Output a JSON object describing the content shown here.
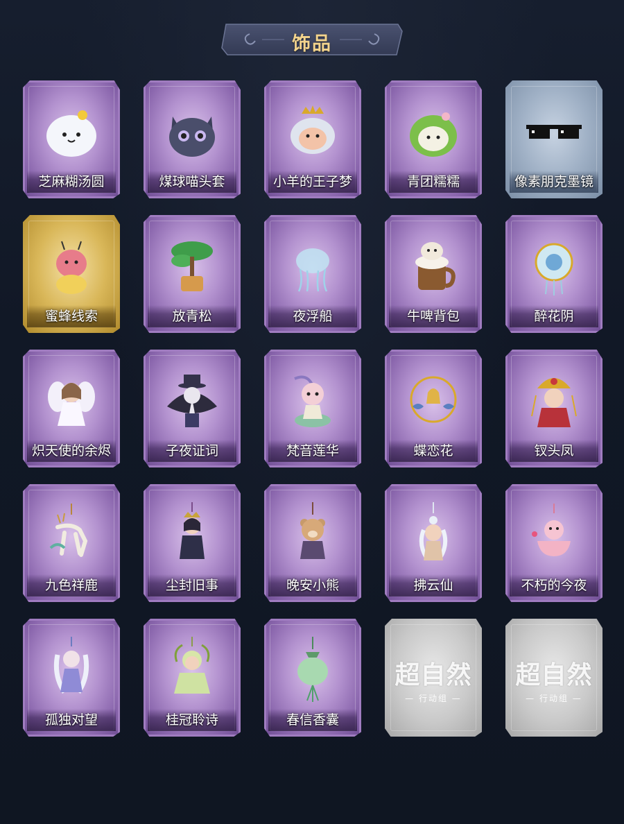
{
  "header": {
    "title": "饰品"
  },
  "items": [
    {
      "name": "芝麻糊汤圆",
      "rarity": "purple",
      "icon": "rice-ball-icon"
    },
    {
      "name": "煤球喵头套",
      "rarity": "purple",
      "icon": "cat-head-icon"
    },
    {
      "name": "小羊的王子梦",
      "rarity": "purple",
      "icon": "crowned-sheep-icon"
    },
    {
      "name": "青团糯糯",
      "rarity": "purple",
      "icon": "green-dumpling-icon"
    },
    {
      "name": "像素朋克墨镜",
      "rarity": "blue",
      "icon": "pixel-sunglasses-icon"
    },
    {
      "name": "蜜蜂线索",
      "rarity": "gold",
      "icon": "bee-costume-icon"
    },
    {
      "name": "放青松",
      "rarity": "purple",
      "icon": "bonsai-pine-icon"
    },
    {
      "name": "夜浮船",
      "rarity": "purple",
      "icon": "jellyfish-icon"
    },
    {
      "name": "牛啤背包",
      "rarity": "purple",
      "icon": "cow-beer-mug-icon"
    },
    {
      "name": "醉花阴",
      "rarity": "purple",
      "icon": "flower-fan-icon"
    },
    {
      "name": "炽天使的余烬",
      "rarity": "purple",
      "icon": "angel-figure-icon"
    },
    {
      "name": "子夜证词",
      "rarity": "purple",
      "icon": "plague-doctor-icon"
    },
    {
      "name": "梵音莲华",
      "rarity": "purple",
      "icon": "lotus-figure-icon"
    },
    {
      "name": "蝶恋花",
      "rarity": "purple",
      "icon": "bell-ring-icon"
    },
    {
      "name": "钗头凤",
      "rarity": "purple",
      "icon": "phoenix-crown-figure-icon"
    },
    {
      "name": "九色祥鹿",
      "rarity": "purple",
      "icon": "deer-charm-icon"
    },
    {
      "name": "尘封旧事",
      "rarity": "purple",
      "icon": "crowned-figure-charm-icon"
    },
    {
      "name": "晚安小熊",
      "rarity": "purple",
      "icon": "bear-charm-icon"
    },
    {
      "name": "拂云仙",
      "rarity": "purple",
      "icon": "fairy-charm-icon"
    },
    {
      "name": "不朽的今夜",
      "rarity": "purple",
      "icon": "pink-bowl-charm-icon"
    },
    {
      "name": "孤独对望",
      "rarity": "purple",
      "icon": "moon-figure-charm-icon"
    },
    {
      "name": "桂冠聆诗",
      "rarity": "purple",
      "icon": "laurel-figure-charm-icon"
    },
    {
      "name": "春信香囊",
      "rarity": "purple",
      "icon": "sachet-charm-icon"
    },
    {
      "name": "",
      "rarity": "gray",
      "icon": "placeholder-logo-icon",
      "watermark": "超自然",
      "watermark_sub": "— 行动组 —"
    },
    {
      "name": "",
      "rarity": "gray",
      "icon": "placeholder-logo-icon",
      "watermark": "超自然",
      "watermark_sub": "— 行动组 —"
    }
  ]
}
